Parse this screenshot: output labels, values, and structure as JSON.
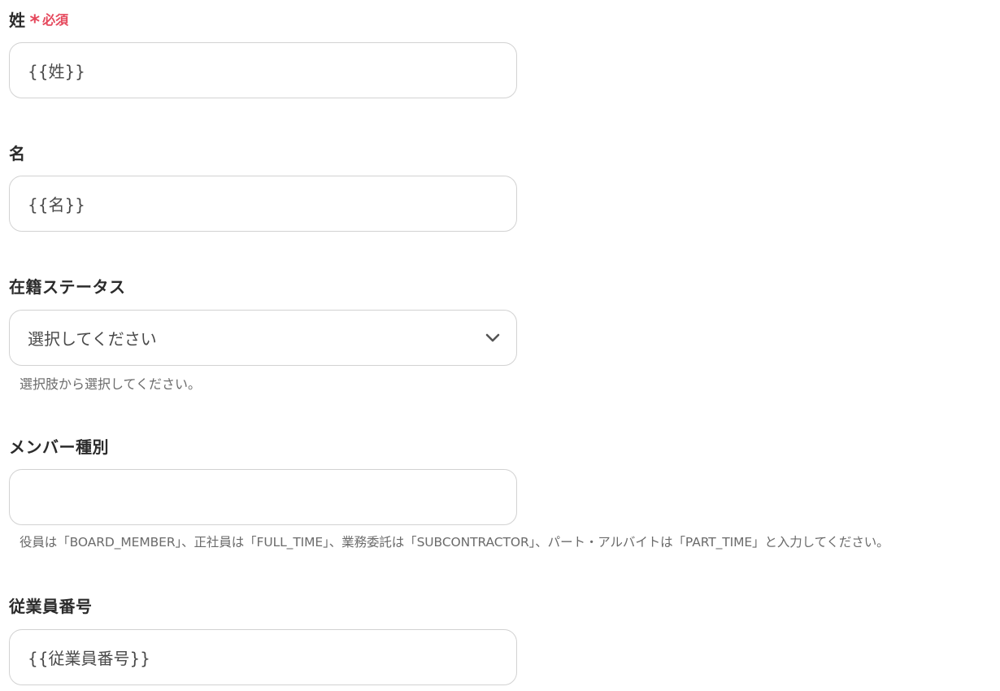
{
  "fields": {
    "last_name": {
      "label": "姓",
      "required_mark": "*",
      "required_text": "必須",
      "value": "{{姓}}"
    },
    "first_name": {
      "label": "名",
      "value": "{{名}}"
    },
    "employment_status": {
      "label": "在籍ステータス",
      "selected": "選択してください",
      "help": "選択肢から選択してください。",
      "icon": "chevron-down-icon"
    },
    "member_type": {
      "label": "メンバー種別",
      "value": "",
      "help": "役員は「BOARD_MEMBER」、正社員は「FULL_TIME」、業務委託は「SUBCONTRACTOR」、パート・アルバイトは「PART_TIME」と入力してください。"
    },
    "employee_number": {
      "label": "従業員番号",
      "value": "{{従業員番号}}"
    }
  },
  "colors": {
    "required": "#e5485c",
    "border": "#d2d2d2",
    "help_text": "#6b6b6b"
  }
}
